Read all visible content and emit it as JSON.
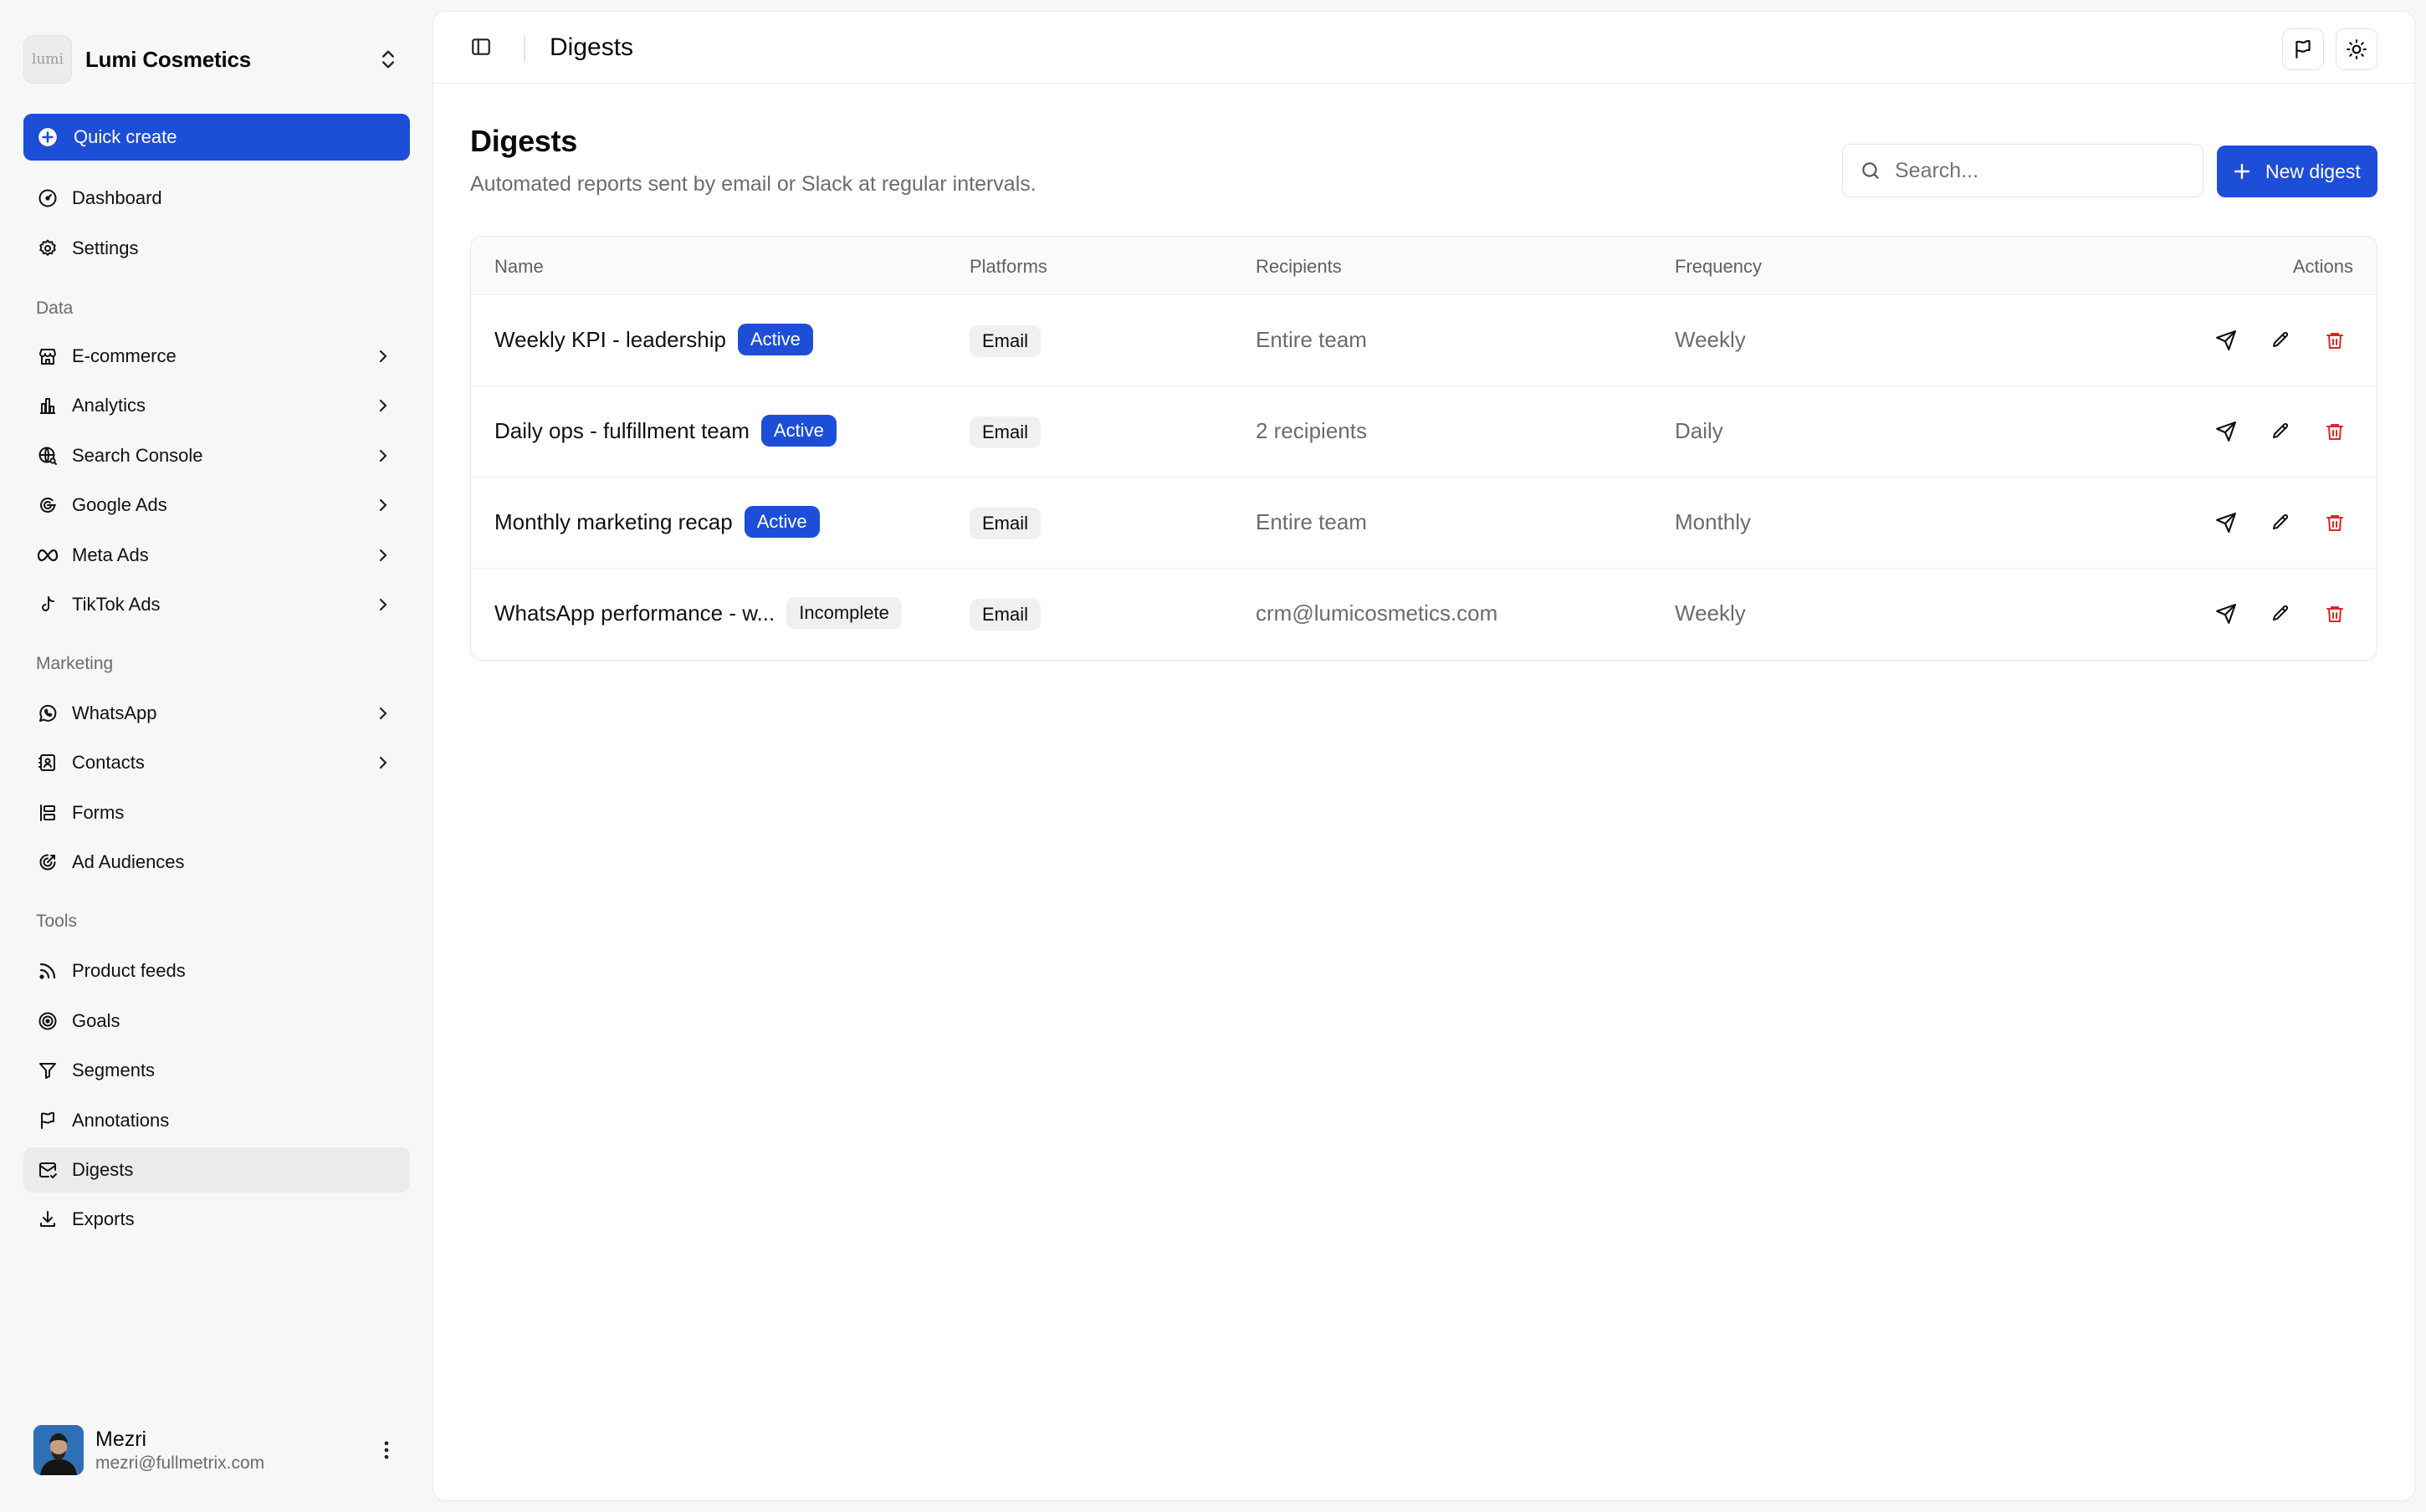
{
  "workspace": {
    "name": "Lumi Cosmetics",
    "logo_text": "lumi"
  },
  "sidebar": {
    "quick_create": "Quick create",
    "top_items": [
      {
        "label": "Dashboard",
        "icon": "dashboard-icon"
      },
      {
        "label": "Settings",
        "icon": "gear-icon"
      }
    ],
    "sections": [
      {
        "label": "Data",
        "items": [
          {
            "label": "E-commerce",
            "icon": "store-icon",
            "has_submenu": true
          },
          {
            "label": "Analytics",
            "icon": "bar-chart-icon",
            "has_submenu": true
          },
          {
            "label": "Search Console",
            "icon": "globe-search-icon",
            "has_submenu": true
          },
          {
            "label": "Google Ads",
            "icon": "google-icon",
            "has_submenu": true
          },
          {
            "label": "Meta Ads",
            "icon": "meta-icon",
            "has_submenu": true
          },
          {
            "label": "TikTok Ads",
            "icon": "tiktok-icon",
            "has_submenu": true
          }
        ]
      },
      {
        "label": "Marketing",
        "items": [
          {
            "label": "WhatsApp",
            "icon": "whatsapp-icon",
            "has_submenu": true
          },
          {
            "label": "Contacts",
            "icon": "contacts-icon",
            "has_submenu": true
          },
          {
            "label": "Forms",
            "icon": "form-icon",
            "has_submenu": false
          },
          {
            "label": "Ad Audiences",
            "icon": "target-icon",
            "has_submenu": false
          }
        ]
      },
      {
        "label": "Tools",
        "items": [
          {
            "label": "Product feeds",
            "icon": "rss-icon",
            "has_submenu": false
          },
          {
            "label": "Goals",
            "icon": "goal-icon",
            "has_submenu": false
          },
          {
            "label": "Segments",
            "icon": "filter-icon",
            "has_submenu": false
          },
          {
            "label": "Annotations",
            "icon": "flag-icon",
            "has_submenu": false
          },
          {
            "label": "Digests",
            "icon": "mail-check-icon",
            "has_submenu": false,
            "active": true
          },
          {
            "label": "Exports",
            "icon": "download-icon",
            "has_submenu": false
          }
        ]
      }
    ]
  },
  "user": {
    "name": "Mezri",
    "email": "mezri@fullmetrix.com"
  },
  "topbar": {
    "title": "Digests"
  },
  "page": {
    "title": "Digests",
    "subtitle": "Automated reports sent by email or Slack at regular intervals.",
    "search_placeholder": "Search...",
    "new_button": "New digest"
  },
  "table": {
    "headers": {
      "name": "Name",
      "platforms": "Platforms",
      "recipients": "Recipients",
      "frequency": "Frequency",
      "actions": "Actions"
    },
    "rows": [
      {
        "name": "Weekly KPI - leadership",
        "status": "Active",
        "platform": "Email",
        "recipients": "Entire team",
        "frequency": "Weekly"
      },
      {
        "name": "Daily ops - fulfillment team",
        "status": "Active",
        "platform": "Email",
        "recipients": "2 recipients",
        "frequency": "Daily"
      },
      {
        "name": "Monthly marketing recap",
        "status": "Active",
        "platform": "Email",
        "recipients": "Entire team",
        "frequency": "Monthly"
      },
      {
        "name": "WhatsApp performance - w...",
        "status": "Incomplete",
        "platform": "Email",
        "recipients": "crm@lumicosmetics.com",
        "frequency": "Weekly"
      }
    ]
  },
  "colors": {
    "accent": "#1d4ed8",
    "danger": "#dc2626",
    "sidebar_bg": "#f7f7f8"
  }
}
